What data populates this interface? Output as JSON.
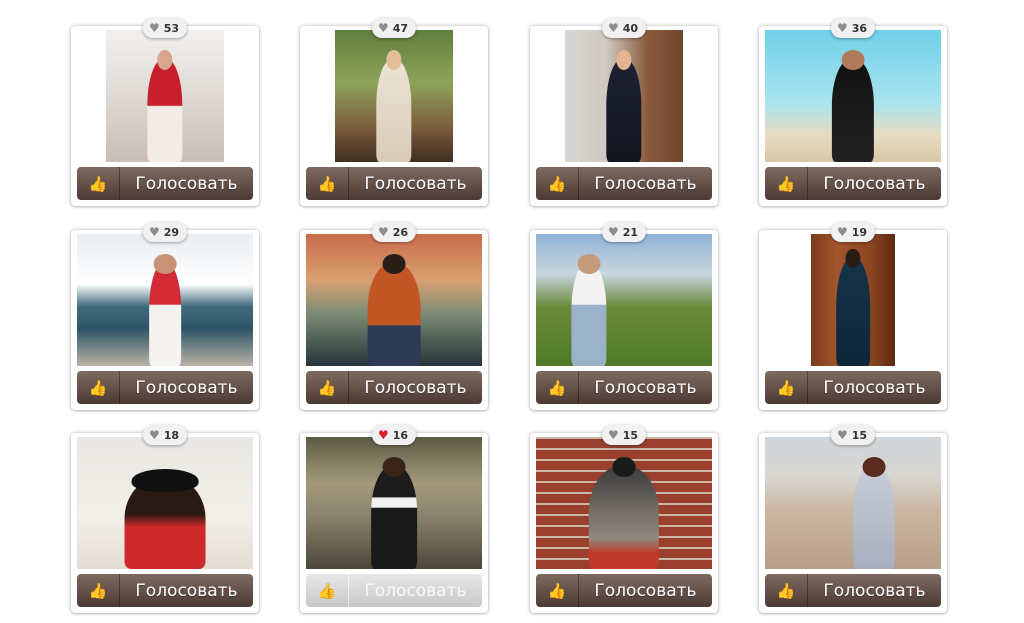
{
  "vote_label": "Голосовать",
  "icons": {
    "like": "heart-icon",
    "vote": "thumbs-up-icon"
  },
  "colors": {
    "button": "#5e4a42",
    "button_disabled": "#d4d4d4",
    "liked_heart": "#d6232a"
  },
  "entries": [
    {
      "likes": "53",
      "liked": false
    },
    {
      "likes": "47",
      "liked": false
    },
    {
      "likes": "40",
      "liked": false
    },
    {
      "likes": "36",
      "liked": false
    },
    {
      "likes": "29",
      "liked": false
    },
    {
      "likes": "26",
      "liked": false
    },
    {
      "likes": "21",
      "liked": false
    },
    {
      "likes": "19",
      "liked": false
    },
    {
      "likes": "18",
      "liked": false
    },
    {
      "likes": "16",
      "liked": true
    },
    {
      "likes": "15",
      "liked": false
    },
    {
      "likes": "15",
      "liked": false
    }
  ]
}
